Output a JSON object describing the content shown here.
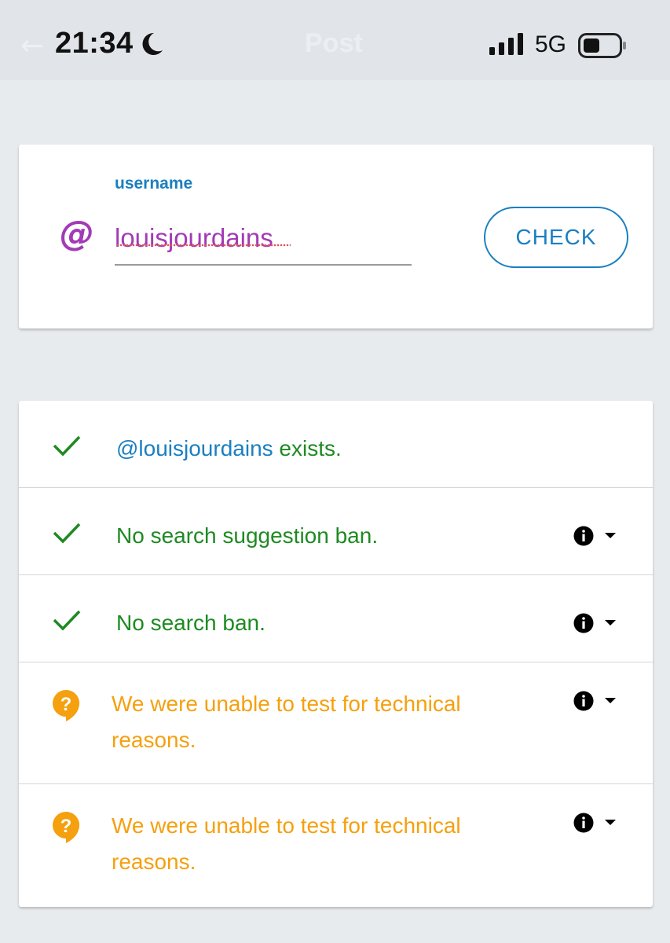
{
  "status_bar": {
    "time": "21:34",
    "network": "5G",
    "ghost_title": "Post",
    "icons": [
      "moon-icon",
      "signal-icon",
      "battery-icon"
    ]
  },
  "check_form": {
    "label": "username",
    "at_symbol": "@",
    "username_value": "louisjourdains",
    "button_label": "CHECK"
  },
  "results": {
    "exists": {
      "handle": "@louisjourdains",
      "text": " exists.",
      "status": "ok"
    },
    "items": [
      {
        "text": "No search suggestion ban.",
        "status": "ok"
      },
      {
        "text": "No search ban.",
        "status": "ok"
      },
      {
        "text": "We were unable to test for technical reasons.",
        "status": "unknown"
      },
      {
        "text": "We were unable to test for technical reasons.",
        "status": "unknown"
      }
    ]
  },
  "colors": {
    "accent_blue": "#1a7fc0",
    "ok_green": "#1e8a22",
    "warn_orange": "#f5a00f",
    "username_purple": "#a23bb5",
    "background": "#e8ebee"
  }
}
